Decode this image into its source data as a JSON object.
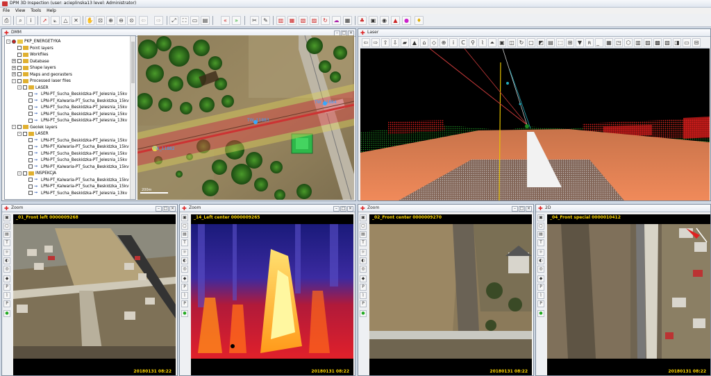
{
  "window": {
    "title": "DPM 3D Inspection (user: acieplinska13 level: Administrator)"
  },
  "menu": [
    "File",
    "View",
    "Tools",
    "Help"
  ],
  "panels": {
    "dmm": {
      "title": "DMM"
    },
    "laser": {
      "title": "Laser"
    },
    "zoom1": {
      "title": "Zoom",
      "caption": "_01_Front left 0000009268",
      "stamp": "20180131 08:22"
    },
    "zoom2": {
      "title": "Zoom",
      "caption": "_14_Left center 0000009265",
      "stamp": "20180131 08:22"
    },
    "zoom3": {
      "title": "Zoom",
      "caption": "_02_Front center 0000009270",
      "stamp": "20180131 08:22"
    },
    "view2d": {
      "title": "2D",
      "caption": "_04_Front special 0000010412",
      "stamp": "20180131 08:22"
    }
  },
  "tree": [
    {
      "label": "PKP_ENERGETYKA",
      "level": 0,
      "exp": "-",
      "kind": "root"
    },
    {
      "label": "Point layers",
      "level": 1,
      "exp": "",
      "kind": "folder"
    },
    {
      "label": "Workfiles",
      "level": 1,
      "exp": "",
      "kind": "folder"
    },
    {
      "label": "Database",
      "level": 1,
      "exp": "+",
      "kind": "folder"
    },
    {
      "label": "Shape layers",
      "level": 1,
      "exp": "+",
      "kind": "folder"
    },
    {
      "label": "Maps and georasters",
      "level": 1,
      "exp": "+",
      "kind": "folder"
    },
    {
      "label": "Processed laser files",
      "level": 1,
      "exp": "-",
      "kind": "folder"
    },
    {
      "label": "LASER",
      "level": 2,
      "exp": "-",
      "kind": "folder"
    },
    {
      "label": "LPN-PT_Sucha_Beskidzka-PT_Jelesnia_15kv",
      "level": 3,
      "exp": "",
      "kind": "leaf"
    },
    {
      "label": "LPN-PT_Kalwaria-PT_Sucha_Beskidzka_15kv",
      "level": 3,
      "exp": "",
      "kind": "leaf"
    },
    {
      "label": "LPN-PT_Sucha_Beskidzka-PT_Jelesnia_15kv",
      "level": 3,
      "exp": "",
      "kind": "leaf"
    },
    {
      "label": "LPN-PT_Sucha_Beskidzka-PT_Jelesnia_15kv",
      "level": 3,
      "exp": "",
      "kind": "leaf"
    },
    {
      "label": "LPN-PT_Sucha_Beskidzka-PT_Jelesnia_13kv",
      "level": 3,
      "exp": "",
      "kind": "leaf"
    },
    {
      "label": "Geolek layers",
      "level": 1,
      "exp": "-",
      "kind": "folder"
    },
    {
      "label": "LASER",
      "level": 2,
      "exp": "-",
      "kind": "folder"
    },
    {
      "label": "LPN-PT_Sucha_Beskidzka-PT_Jelesnia_15kv",
      "level": 3,
      "exp": "",
      "kind": "leaf"
    },
    {
      "label": "LPN-PT_Kalwaria-PT_Sucha_Beskidzka_15kv",
      "level": 3,
      "exp": "",
      "kind": "leaf"
    },
    {
      "label": "LPN-PT_Sucha_Beskidzka-PT_Jelesnia_15kv",
      "level": 3,
      "exp": "",
      "kind": "leaf"
    },
    {
      "label": "LPN-PT_Sucha_Beskidzka-PT_Jelesnia_15kv",
      "level": 3,
      "exp": "",
      "kind": "leaf"
    },
    {
      "label": "LPN-PT_Kalwaria-PT_Sucha_Beskidzka_15kv",
      "level": 3,
      "exp": "",
      "kind": "leaf"
    },
    {
      "label": "INSPEKCJA",
      "level": 2,
      "exp": "-",
      "kind": "folder"
    },
    {
      "label": "LPN-PT_Kalwaria-PT_Sucha_Beskidzka_15kv",
      "level": 3,
      "exp": "",
      "kind": "leaf"
    },
    {
      "label": "LPN-PT_Kalwaria-PT_Sucha_Beskidzka_15kv",
      "level": 3,
      "exp": "",
      "kind": "leaf"
    },
    {
      "label": "LPN-PT_Sucha_Beskidzka-PT_Jelesnia_13kv",
      "level": 3,
      "exp": "",
      "kind": "leaf"
    }
  ],
  "map": {
    "labels": [
      "TW_11884",
      "TW_11883",
      "TW_11882"
    ],
    "scale": "200m"
  },
  "colors": {
    "accent": "#d22222",
    "panel_bg": "#000000",
    "caption": "#ffd700"
  }
}
